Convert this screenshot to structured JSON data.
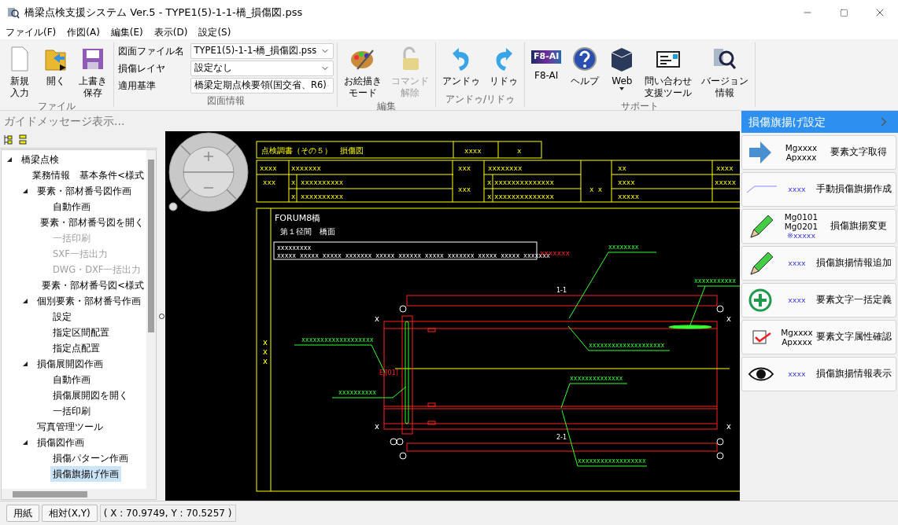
{
  "window": {
    "title": "橋梁点検支援システム Ver.5 - TYPE1(5)-1-1-橋_損傷図.pss"
  },
  "menu": [
    "ファイル(F)",
    "作図(A)",
    "編集(E)",
    "表示(D)",
    "設定(S)"
  ],
  "ribbon": {
    "file": {
      "label": "ファイル",
      "buttons": [
        {
          "lines": [
            "新規",
            "入力"
          ],
          "disabled": false
        },
        {
          "lines": [
            "開く"
          ],
          "disabled": false
        },
        {
          "lines": [
            "上書き",
            "保存"
          ],
          "disabled": false
        }
      ]
    },
    "drawing_info": {
      "label": "図面情報",
      "fields": [
        {
          "label": "図面ファイル名",
          "value": "TYPE1(5)-1-1-橋_損傷図.pss"
        },
        {
          "label": "損傷レイヤ",
          "value": "設定なし"
        },
        {
          "label": "適用基準",
          "value": "橋梁定期点検要領(国交省、R6)"
        }
      ]
    },
    "edit": {
      "label": "編集",
      "buttons": [
        {
          "lines": [
            "お絵描き",
            "モード"
          ],
          "disabled": false
        },
        {
          "lines": [
            "コマンド",
            "解除"
          ],
          "disabled": true
        }
      ]
    },
    "undo": {
      "label": "アンドゥ/リドゥ",
      "buttons": [
        {
          "lines": [
            "アンドゥ"
          ],
          "disabled": false
        },
        {
          "lines": [
            "リドゥ"
          ],
          "disabled": false
        }
      ]
    },
    "support": {
      "label": "サポート",
      "logo_text": "F8-AI",
      "buttons": [
        {
          "lines": [
            "F8-AI"
          ],
          "disabled": false
        },
        {
          "lines": [
            "ヘルプ"
          ],
          "disabled": false
        },
        {
          "lines": [
            "Web"
          ],
          "disabled": false
        },
        {
          "lines": [
            "問い合わせ",
            "支援ツール"
          ],
          "disabled": false
        },
        {
          "lines": [
            "バージョン",
            "情報"
          ],
          "disabled": false
        }
      ]
    }
  },
  "guide_message": "ガイドメッセージ表示...",
  "tree": [
    {
      "label": "橋梁点検",
      "expanded": true,
      "selected": false,
      "disabled": false,
      "children": [
        {
          "label": "業務情報　基本条件<様式",
          "selected": false,
          "disabled": false
        },
        {
          "label": "要素・部材番号図作画",
          "expanded": true,
          "selected": false,
          "disabled": false,
          "children": [
            {
              "label": "自動作画",
              "selected": false,
              "disabled": false
            },
            {
              "label": "要素・部材番号図を開く",
              "selected": false,
              "disabled": false
            },
            {
              "label": "一括印刷",
              "selected": false,
              "disabled": true
            },
            {
              "label": "SXF一括出力",
              "selected": false,
              "disabled": true
            },
            {
              "label": "DWG・DXF一括出力",
              "selected": false,
              "disabled": true
            },
            {
              "label": "要素・部材番号図<様式",
              "selected": false,
              "disabled": false
            }
          ]
        },
        {
          "label": "個別要素・部材番号作画",
          "expanded": true,
          "selected": false,
          "disabled": false,
          "children": [
            {
              "label": "設定",
              "selected": false,
              "disabled": false
            },
            {
              "label": "指定区間配置",
              "selected": false,
              "disabled": false
            },
            {
              "label": "指定点配置",
              "selected": false,
              "disabled": false
            }
          ]
        },
        {
          "label": "損傷展開図作画",
          "expanded": true,
          "selected": false,
          "disabled": false,
          "children": [
            {
              "label": "自動作画",
              "selected": false,
              "disabled": false
            },
            {
              "label": "損傷展開図を開く",
              "selected": false,
              "disabled": false
            },
            {
              "label": "一括印刷",
              "selected": false,
              "disabled": false
            }
          ]
        },
        {
          "label": "写真管理ツール",
          "selected": false,
          "disabled": false
        },
        {
          "label": "損傷図作画",
          "expanded": true,
          "selected": false,
          "disabled": false,
          "children": [
            {
              "label": "損傷パターン作画",
              "selected": false,
              "disabled": false
            },
            {
              "label": "損傷旗揚げ作画",
              "selected": true,
              "disabled": false
            }
          ]
        }
      ]
    }
  ],
  "drawing": {
    "sheet_title": "点検調書（その５）　損傷図",
    "header_cells": [
      "xxxx",
      "x"
    ],
    "info_cells": [
      "xxxx",
      "xxxxxxx",
      "xxx",
      "xxxxxxxx",
      "xx",
      "xxxx",
      "xxx",
      "x",
      "xxxxxxxxxx",
      "x",
      "xxxxxxxxxx",
      "xxx",
      "x",
      "xxxxxxxxxxxxxx",
      "x",
      "xxxxxxxxxxxxxx",
      "x x",
      "xxxx",
      "xxxxx",
      "xxxxx"
    ],
    "bridge_name": "FORUM8橋",
    "span_title": "第１径間　橋面",
    "note_lines": [
      "xxxxxxxxx",
      "xxxxx xxxxx xxxxx xxxxxxx xxxxx xxxxxx xxxxx xxxxxxx xxxxx xxxxx xxxxxxx"
    ],
    "note_tag": "xxxxxxx",
    "side_mark": "x\nx\nx",
    "section_labels": [
      "1-1",
      "2-1"
    ],
    "joint_label": "EJ[01]",
    "damage_labels": [
      "xxxxxxxx",
      "xxxxxxxxxxx",
      "xxxxxxxxxxxxxxxxxxxx",
      "xxxxxxxxxxxxxxxxxxx",
      "xxxxxxxxxx",
      "xxxxxxxxxxxxxx",
      "xxxxxxxxxxxxxxxxxx"
    ],
    "crosses": [
      "x",
      "x",
      "x",
      "x"
    ]
  },
  "panel": {
    "title": "損傷旗揚げ設定",
    "tools": [
      {
        "kind": "arrow",
        "icon_text": [
          "Mgxxxx",
          "Apxxxx"
        ],
        "label": "要素文字取得"
      },
      {
        "kind": "leader",
        "icon_text": [
          "xxxx"
        ],
        "label": "手動損傷旗揚作成"
      },
      {
        "kind": "pencil-text",
        "icon_text": [
          "Mg0101",
          "Mg0201",
          "※xxxxx"
        ],
        "label": "損傷旗揚変更"
      },
      {
        "kind": "pencil-leader",
        "icon_text": [
          "xxxx"
        ],
        "label": "損傷旗揚情報追加"
      },
      {
        "kind": "plus-leader",
        "icon_text": [
          "xxxx"
        ],
        "label": "要素文字一括定義"
      },
      {
        "kind": "check-text",
        "icon_text": [
          "Mgxxxx",
          "Apxxxx"
        ],
        "label": "要素文字属性確認"
      },
      {
        "kind": "eye-leader",
        "icon_text": [
          "xxxx"
        ],
        "label": "損傷旗揚情報表示"
      }
    ]
  },
  "status_bar": {
    "buttons": [
      "用紙",
      "相対(X,Y)"
    ],
    "coordinates": "( X : 70.9749, Y : 70.5257 )"
  }
}
